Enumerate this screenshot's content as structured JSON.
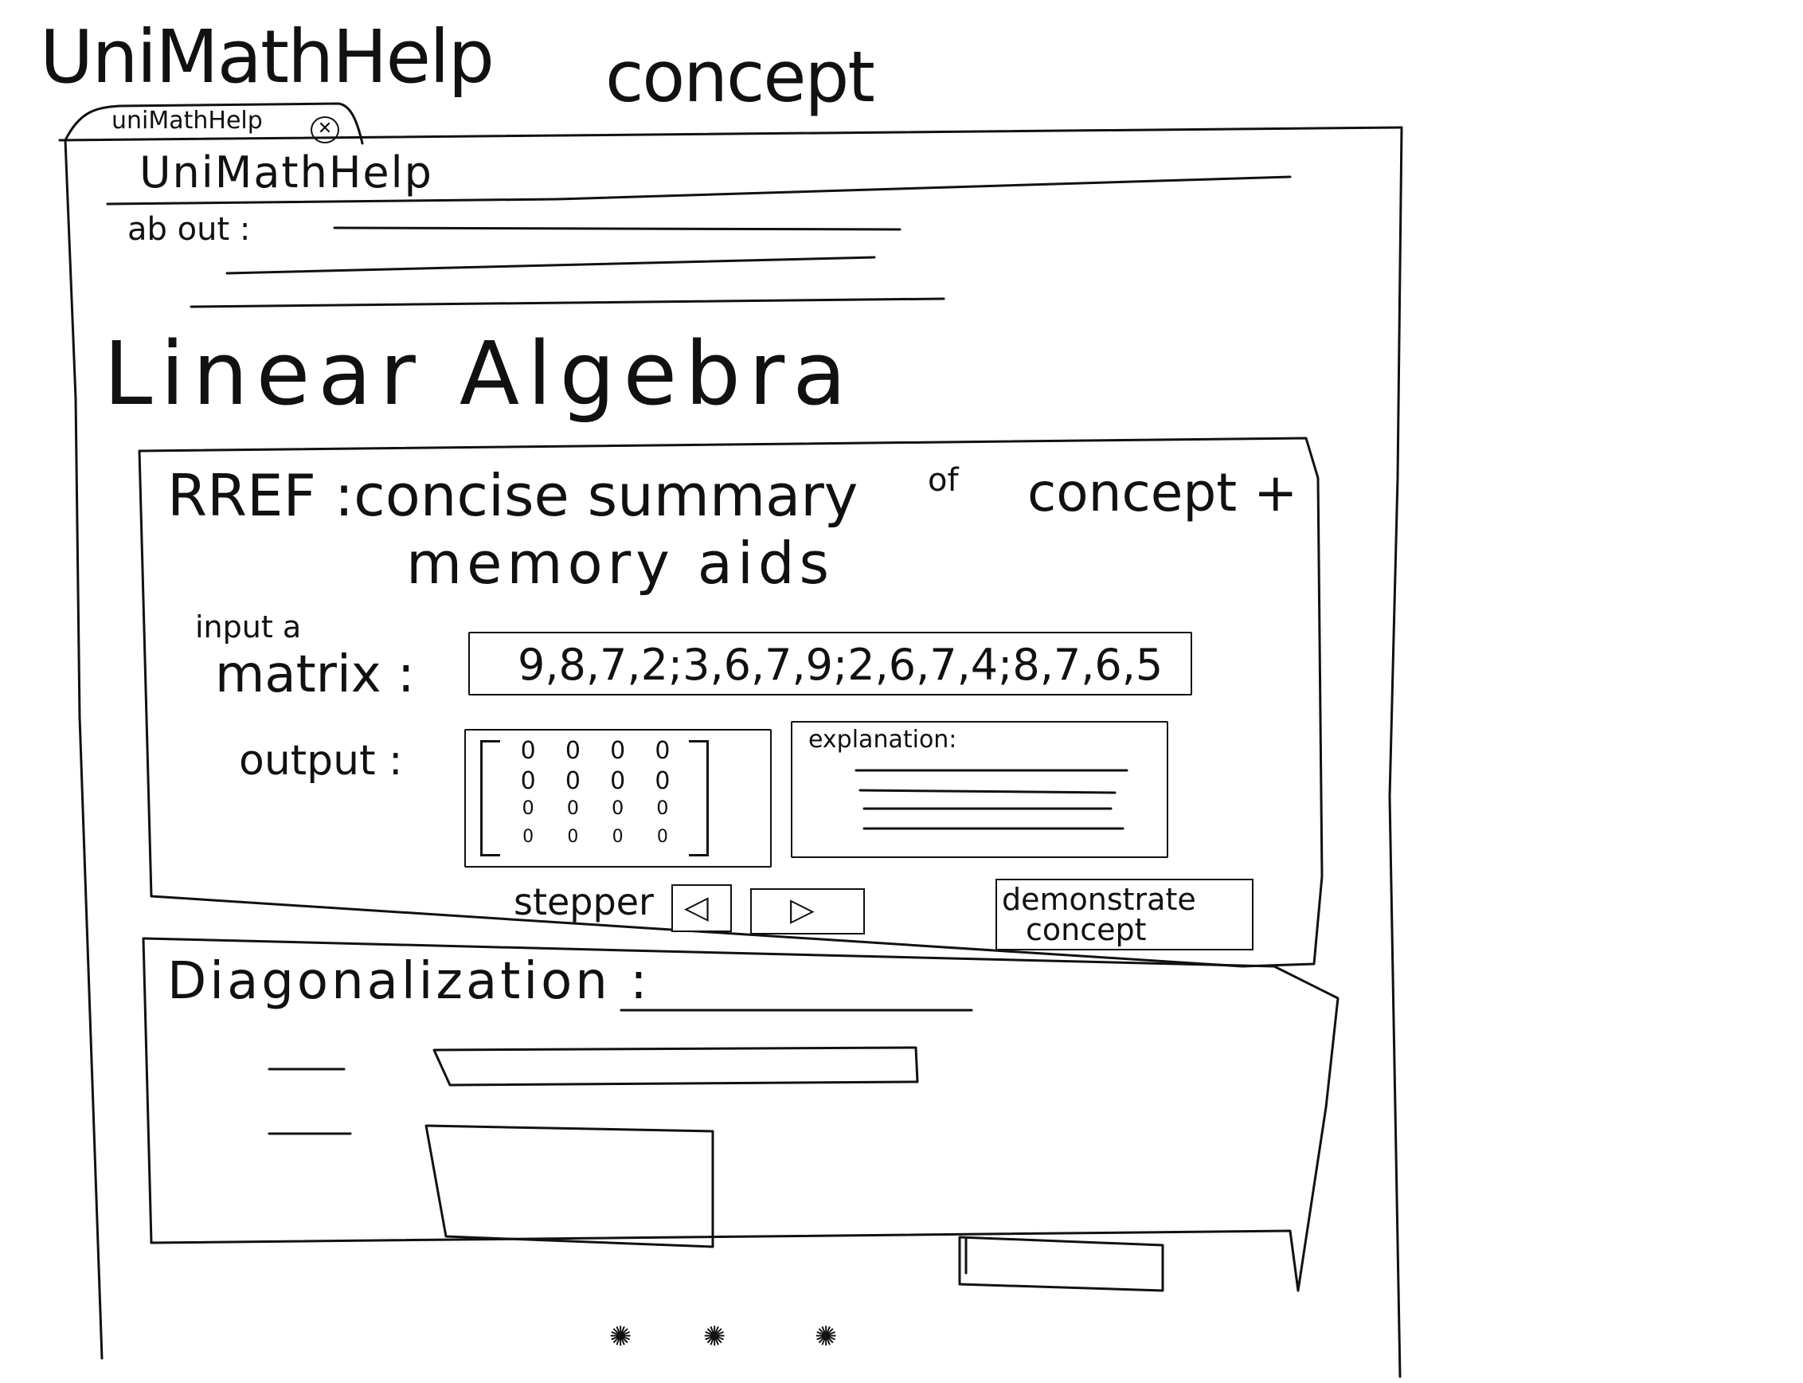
{
  "sketch": {
    "title": "UniMathHelp",
    "subtitle": "concept"
  },
  "browser": {
    "tab_label": "uniMathHelp",
    "tab_close_icon": "close-icon"
  },
  "site": {
    "header_title": "UniMathHelp",
    "about_label": "ab out :"
  },
  "section": {
    "title": "Linear Algebra"
  },
  "rref_card": {
    "heading": "RREF :concise summary",
    "heading_of": "of",
    "heading_tail": "concept +",
    "heading_line2": "memory aids",
    "input_label_small": "input a",
    "input_label_big": "matrix :",
    "matrix_value": "9,8,7,2;3,6,7,9;2,6,7,4;8,7,6,5",
    "output_label": "output :",
    "output_matrix": [
      [
        "0",
        "0",
        "0",
        "0"
      ],
      [
        "0",
        "0",
        "0",
        "0"
      ],
      [
        "0",
        "0",
        "0",
        "0"
      ],
      [
        "0",
        "0",
        "0",
        "0"
      ]
    ],
    "explanation_label": "explanation:",
    "stepper_label": "stepper",
    "prev_icon": "triangle-left-icon",
    "next_icon": "triangle-right-icon",
    "demonstrate_label_line1": "demonstrate",
    "demonstrate_label_line2": "concept"
  },
  "diag_card": {
    "heading": "Diagonalization :"
  },
  "footer": {
    "icons": [
      "scribble-icon",
      "scribble-icon",
      "scribble-icon"
    ]
  }
}
